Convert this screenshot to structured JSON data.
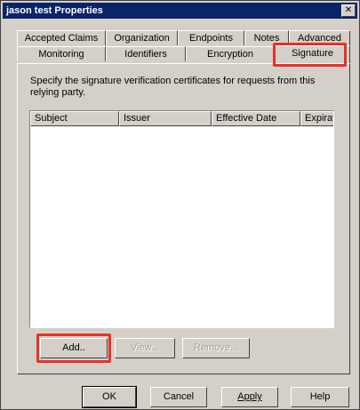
{
  "window": {
    "title": "jason test Properties",
    "close_glyph": "✕"
  },
  "tabs_back": [
    "Accepted Claims",
    "Organization",
    "Endpoints",
    "Notes",
    "Advanced"
  ],
  "tabs_front": [
    "Monitoring",
    "Identifiers",
    "Encryption",
    "Signature"
  ],
  "selected_tab": "Signature",
  "panel": {
    "description": "Specify the signature verification certificates for requests from this relying party.",
    "columns": [
      "Subject",
      "Issuer",
      "Effective Date",
      "Expiratic"
    ],
    "rows": [],
    "buttons": {
      "add": "Add..",
      "view": "View...",
      "remove": "Remove..."
    }
  },
  "dialog_buttons": {
    "ok": "OK",
    "cancel": "Cancel",
    "apply": "Apply",
    "help": "Help"
  },
  "colors": {
    "highlight": "#e8302a",
    "titlebar": "#0a246a",
    "face": "#d4d0c8"
  }
}
